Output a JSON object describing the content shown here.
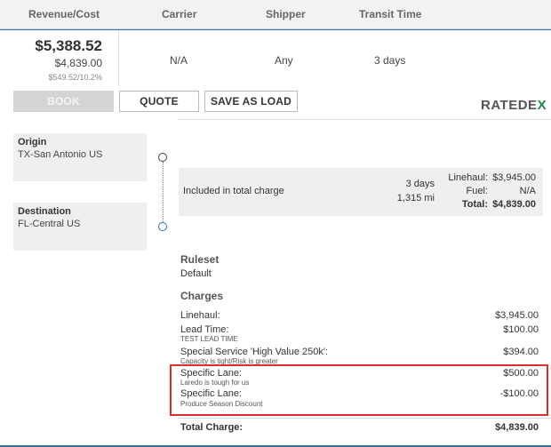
{
  "header": {
    "revenue_cost": "Revenue/Cost",
    "carrier": "Carrier",
    "shipper": "Shipper",
    "transit_time": "Transit Time"
  },
  "quote_row": {
    "revenue": "$5,388.52",
    "cost": "$4,839.00",
    "margin": "$549.52/10.2%",
    "carrier": "N/A",
    "shipper": "Any",
    "transit_time": "3 days"
  },
  "actions": {
    "book": "BOOK",
    "quote": "QUOTE",
    "save_as_load": "SAVE AS LOAD"
  },
  "brand": {
    "logo_text": "RATEDE",
    "logo_accent": "X"
  },
  "route": {
    "origin_label": "Origin",
    "origin_value": "TX-San Antonio US",
    "destination_label": "Destination",
    "destination_value": "FL-Central US"
  },
  "summary": {
    "included": "Included in total charge",
    "days": "3 days",
    "miles": "1,315 mi",
    "linehaul_label": "Linehaul:",
    "linehaul_value": "$3,945.00",
    "fuel_label": "Fuel:",
    "fuel_value": "N/A",
    "total_label": "Total:",
    "total_value": "$4,839.00"
  },
  "ruleset": {
    "title": "Ruleset",
    "value": "Default"
  },
  "charges": {
    "title": "Charges",
    "items": [
      {
        "label": "Linehaul:",
        "sub": "",
        "amount": "$3,945.00"
      },
      {
        "label": "Lead Time:",
        "sub": "TEST LEAD TIME",
        "amount": "$100.00"
      },
      {
        "label": "Special Service 'High Value 250k':",
        "sub": "Capacity is tight/Risk is greater",
        "amount": "$394.00"
      },
      {
        "label": "Specific Lane:",
        "sub": "Laredo is tough for us",
        "amount": "$500.00"
      },
      {
        "label": "Specific Lane:",
        "sub": "Produce Season Discount",
        "amount": "-$100.00"
      }
    ],
    "total_label": "Total Charge:",
    "total_value": "$4,839.00"
  },
  "colors": {
    "accent_blue": "#2d6ea3",
    "highlight_red": "#d62f2f",
    "logo_green": "#1d8a45"
  }
}
